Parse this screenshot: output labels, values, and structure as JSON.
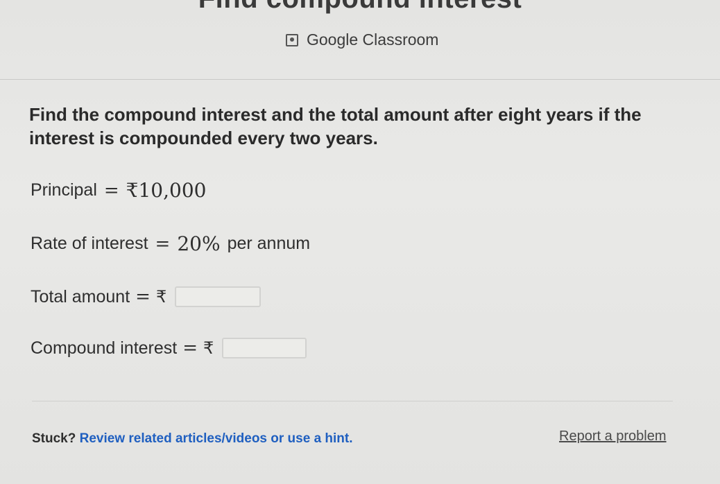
{
  "header": {
    "title": "Find compound interest",
    "classroom_label": "Google Classroom"
  },
  "problem": {
    "text": "Find the compound interest and the total amount after eight years if the interest is compounded every two years."
  },
  "given": {
    "principal_label": "Principal",
    "principal_value": "₹10,000",
    "rate_label": "Rate of interest",
    "rate_value": "20%",
    "rate_unit": "per annum"
  },
  "answers": {
    "equals": "=",
    "currency": "₹",
    "total_label": "Total amount",
    "total_value": "",
    "ci_label": "Compound interest",
    "ci_value": ""
  },
  "footer": {
    "stuck_label": "Stuck?",
    "hint_link": "Review related articles/videos or use a hint.",
    "report_link": "Report a problem"
  },
  "icons": {
    "classroom": "google-classroom-icon"
  },
  "colors": {
    "link": "#1f5fc0",
    "background": "#e6e6e4"
  }
}
